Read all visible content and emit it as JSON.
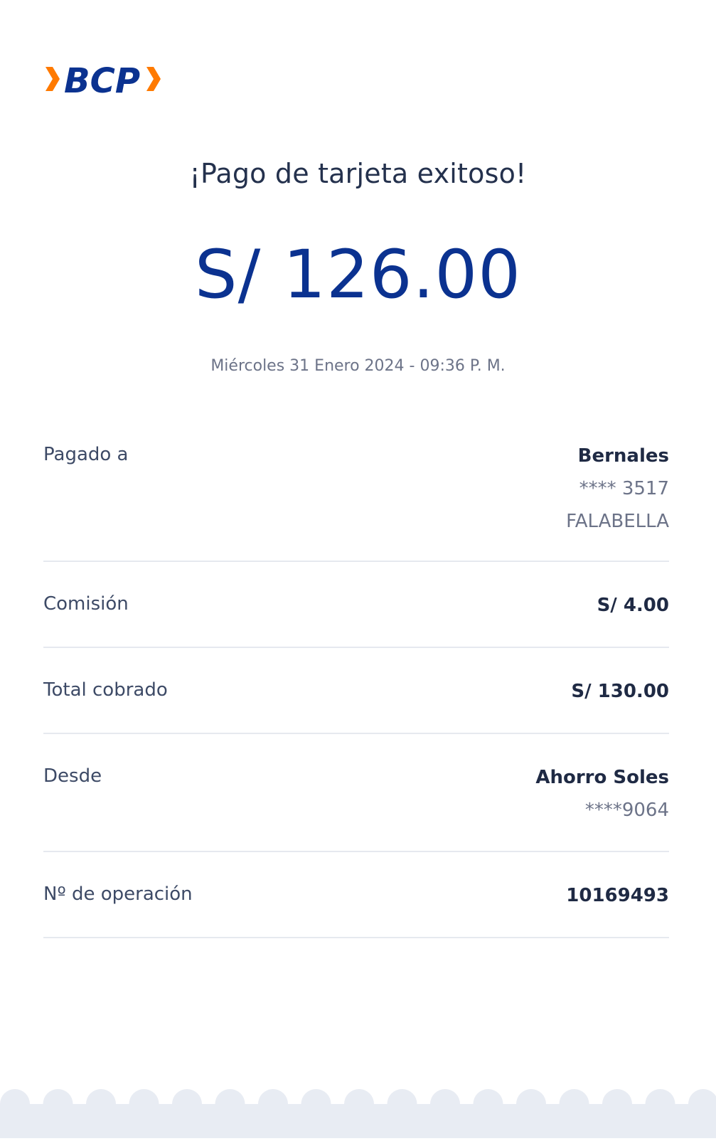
{
  "brand": {
    "logo_text": "BCP",
    "primary_color": "#0b3290",
    "accent_color": "#ff7a00"
  },
  "receipt": {
    "title": "¡Pago de tarjeta exitoso!",
    "amount": "S/ 126.00",
    "datetime": "Miércoles 31 Enero 2024 - 09:36 P. M."
  },
  "details": {
    "paid_to": {
      "label": "Pagado a",
      "name": "Bernales",
      "card": "**** 3517",
      "entity": "FALABELLA"
    },
    "commission": {
      "label": "Comisión",
      "value": "S/ 4.00"
    },
    "total": {
      "label": "Total cobrado",
      "value": "S/ 130.00"
    },
    "from": {
      "label": "Desde",
      "account": "Ahorro Soles",
      "number": "****9064"
    },
    "operation": {
      "label": "Nº de operación",
      "value": "10169493"
    }
  }
}
